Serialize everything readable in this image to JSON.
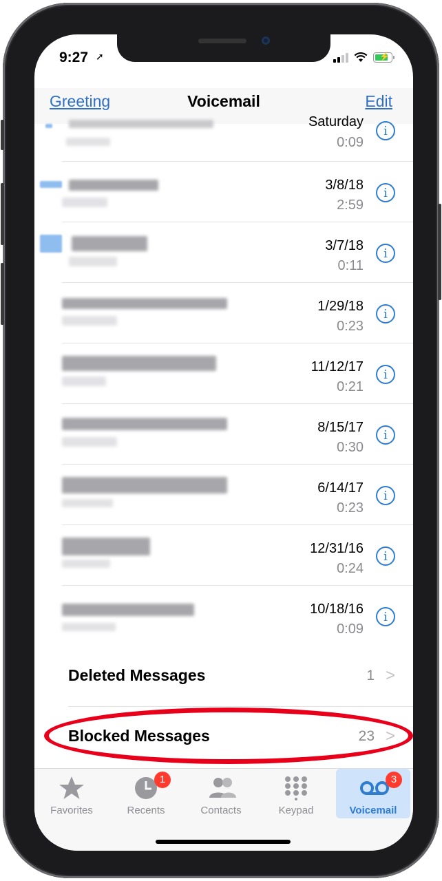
{
  "status": {
    "time": "9:27"
  },
  "nav": {
    "left": "Greeting",
    "title": "Voicemail",
    "right": "Edit"
  },
  "voicemails": [
    {
      "date": "Saturday",
      "duration": "0:09"
    },
    {
      "date": "3/8/18",
      "duration": "2:59"
    },
    {
      "date": "3/7/18",
      "duration": "0:11"
    },
    {
      "date": "1/29/18",
      "duration": "0:23"
    },
    {
      "date": "11/12/17",
      "duration": "0:21"
    },
    {
      "date": "8/15/17",
      "duration": "0:30"
    },
    {
      "date": "6/14/17",
      "duration": "0:23"
    },
    {
      "date": "12/31/16",
      "duration": "0:24"
    },
    {
      "date": "10/18/16",
      "duration": "0:09"
    }
  ],
  "info_glyph": "i",
  "deleted": {
    "label": "Deleted Messages",
    "count": "1"
  },
  "blocked": {
    "label": "Blocked Messages",
    "count": "23"
  },
  "chevron": ">",
  "tabs": [
    {
      "label": "Favorites",
      "icon": "star-icon"
    },
    {
      "label": "Recents",
      "icon": "clock-icon",
      "badge": "1"
    },
    {
      "label": "Contacts",
      "icon": "contacts-icon"
    },
    {
      "label": "Keypad",
      "icon": "keypad-icon"
    },
    {
      "label": "Voicemail",
      "icon": "voicemail-icon",
      "badge": "3",
      "active": true
    }
  ],
  "colors": {
    "accent": "#2f7dd1",
    "annotation": "#e8001b",
    "badge": "#ff3b30"
  }
}
